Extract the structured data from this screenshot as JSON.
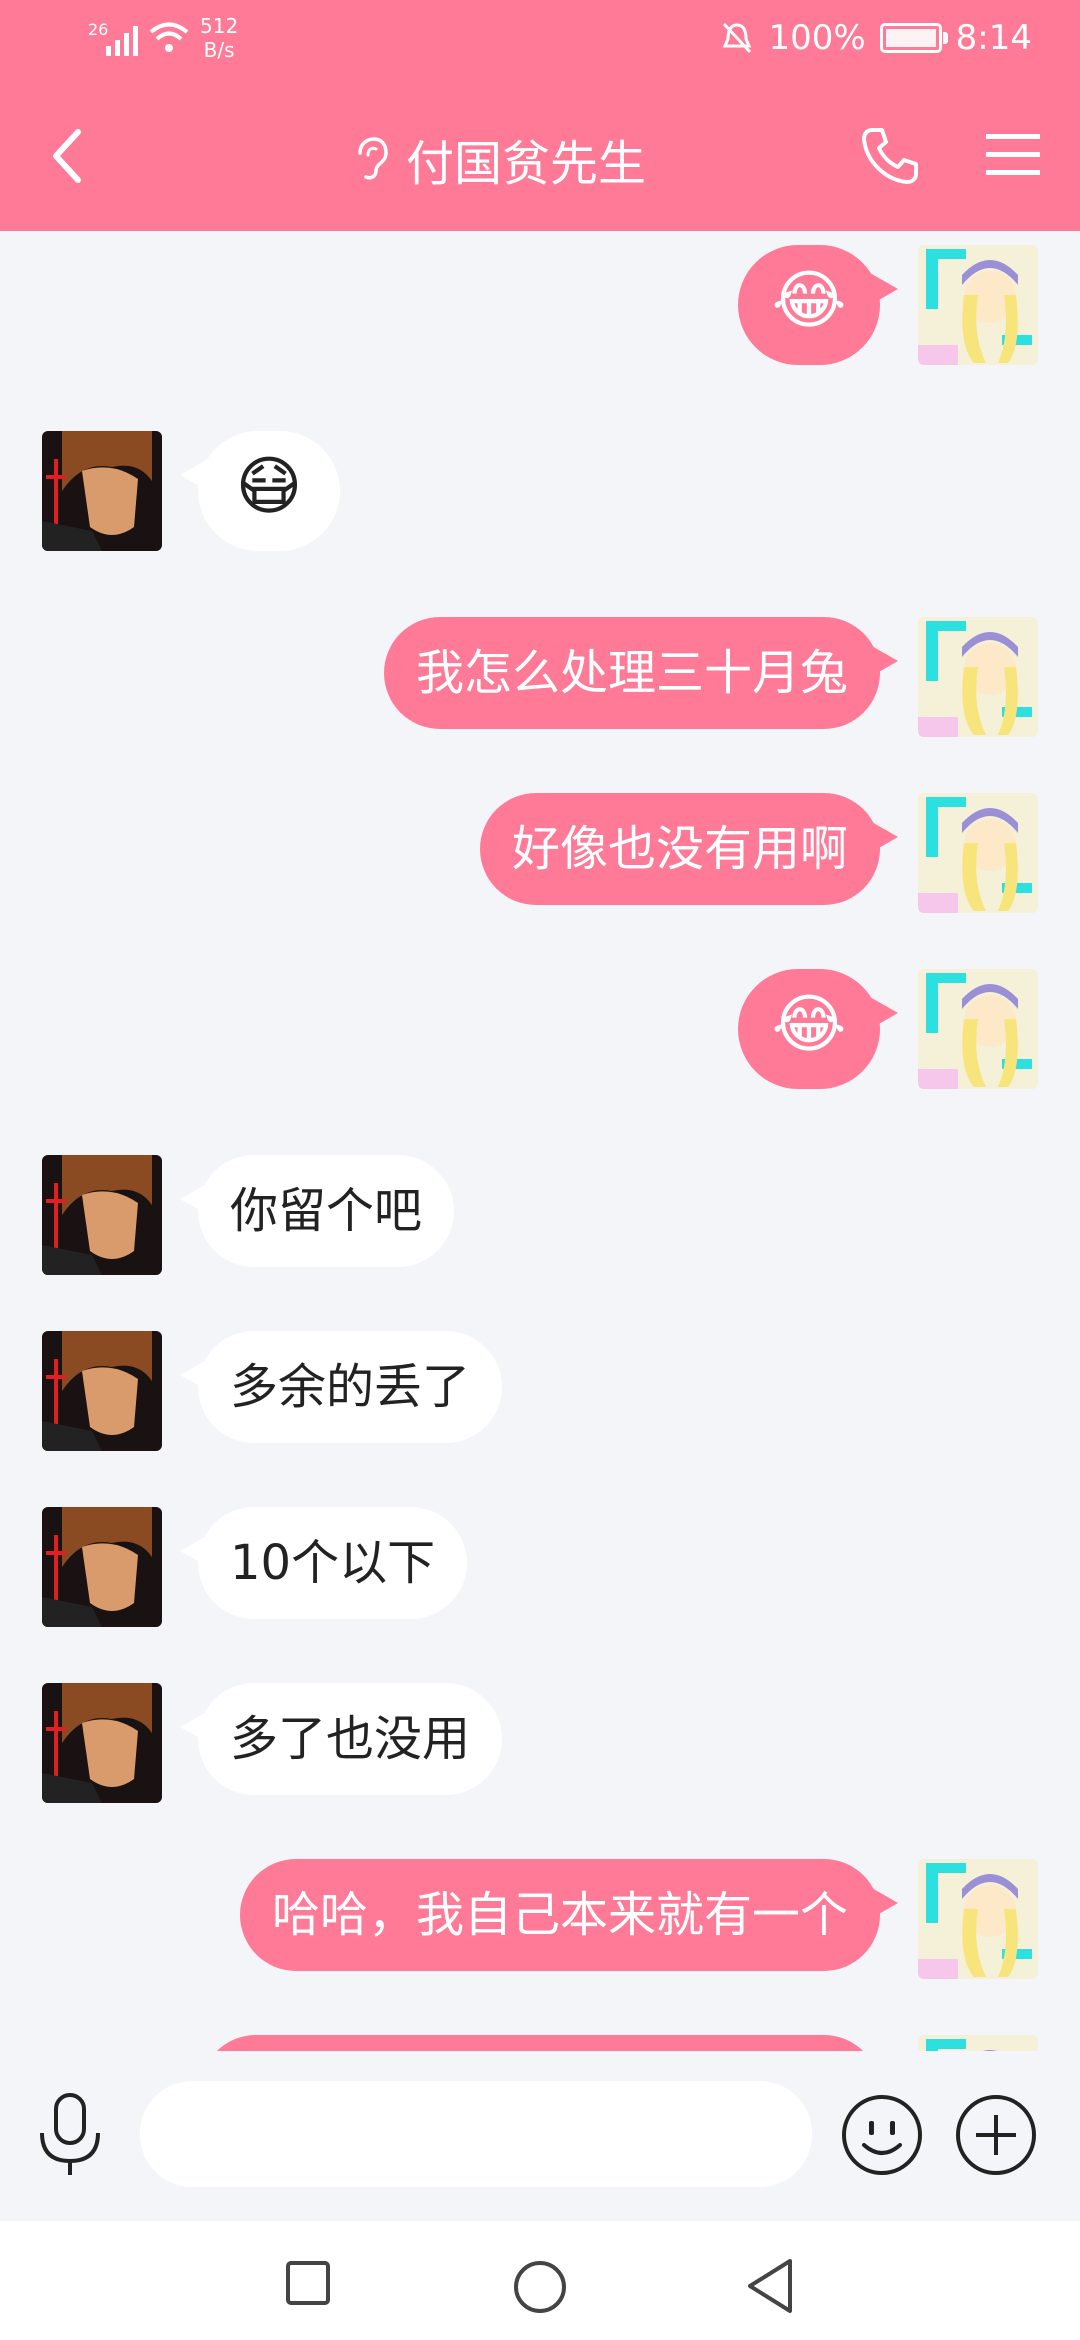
{
  "status": {
    "network": "26",
    "speed_value": "512",
    "speed_unit": "B/s",
    "battery": "100%",
    "time": "8:14"
  },
  "header": {
    "title": "付国贫先生"
  },
  "messages": [
    {
      "side": "me",
      "type": "emoji",
      "content": "😂"
    },
    {
      "side": "them",
      "type": "emoji",
      "content": "😷"
    },
    {
      "side": "me",
      "type": "text",
      "content": "我怎么处理三十月兔"
    },
    {
      "side": "me",
      "type": "text",
      "content": "好像也没有用啊"
    },
    {
      "side": "me",
      "type": "emoji",
      "content": "😂"
    },
    {
      "side": "them",
      "type": "text",
      "content": "你留个吧"
    },
    {
      "side": "them",
      "type": "text",
      "content": "多余的丢了"
    },
    {
      "side": "them",
      "type": "text",
      "content": "10个以下"
    },
    {
      "side": "them",
      "type": "text",
      "content": "多了也没用"
    },
    {
      "side": "me",
      "type": "text",
      "content": "哈哈，我自己本来就有一个"
    }
  ],
  "input": {
    "value": "",
    "placeholder": ""
  },
  "colors": {
    "accent": "#fe7a97",
    "background": "#f4f5f9"
  }
}
